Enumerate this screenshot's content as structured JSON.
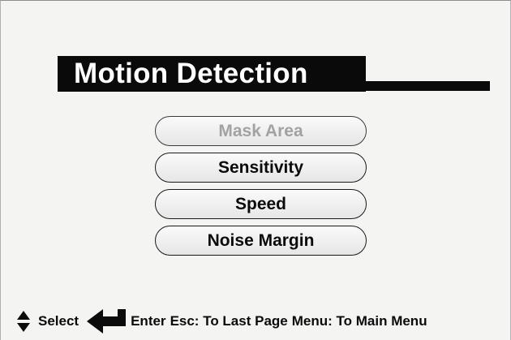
{
  "title": "Motion Detection",
  "menu": {
    "items": [
      {
        "label": "Mask Area",
        "state": "disabled"
      },
      {
        "label": "Sensitivity",
        "state": "enabled"
      },
      {
        "label": "Speed",
        "state": "enabled"
      },
      {
        "label": "Noise Margin",
        "state": "enabled"
      }
    ]
  },
  "footer": {
    "select_icon": "up-down-arrow-icon",
    "select_label": "Select",
    "enter_icon": "enter-arrow-icon",
    "enter_label": "Enter",
    "esc_label": "Esc: To Last Page",
    "menu_label": "Menu: To Main Menu"
  },
  "colors": {
    "title_bg": "#0a0a0a",
    "title_text": "#ffffff",
    "disabled_text": "#a2a2a2",
    "background": "#f4f4f2"
  }
}
